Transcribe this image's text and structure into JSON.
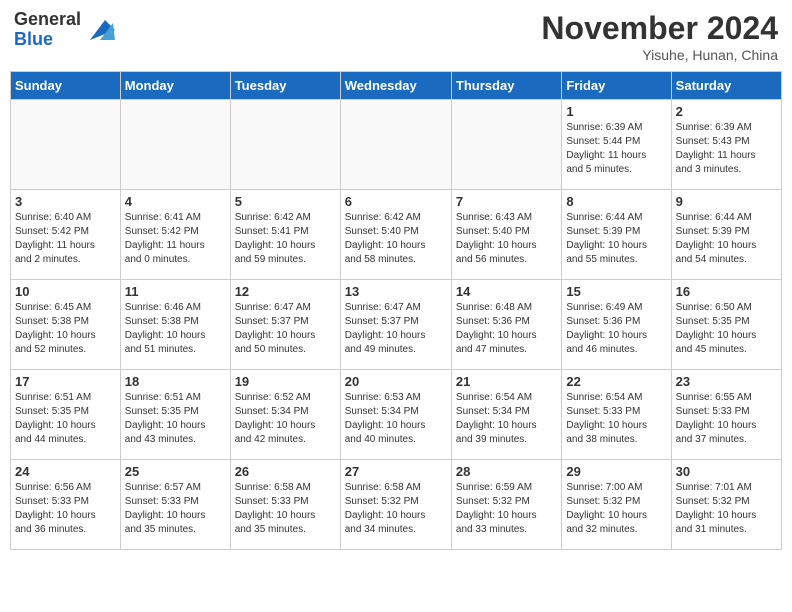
{
  "header": {
    "logo_general": "General",
    "logo_blue": "Blue",
    "month_year": "November 2024",
    "location": "Yisuhe, Hunan, China"
  },
  "weekdays": [
    "Sunday",
    "Monday",
    "Tuesday",
    "Wednesday",
    "Thursday",
    "Friday",
    "Saturday"
  ],
  "weeks": [
    [
      {
        "day": "",
        "info": ""
      },
      {
        "day": "",
        "info": ""
      },
      {
        "day": "",
        "info": ""
      },
      {
        "day": "",
        "info": ""
      },
      {
        "day": "",
        "info": ""
      },
      {
        "day": "1",
        "info": "Sunrise: 6:39 AM\nSunset: 5:44 PM\nDaylight: 11 hours\nand 5 minutes."
      },
      {
        "day": "2",
        "info": "Sunrise: 6:39 AM\nSunset: 5:43 PM\nDaylight: 11 hours\nand 3 minutes."
      }
    ],
    [
      {
        "day": "3",
        "info": "Sunrise: 6:40 AM\nSunset: 5:42 PM\nDaylight: 11 hours\nand 2 minutes."
      },
      {
        "day": "4",
        "info": "Sunrise: 6:41 AM\nSunset: 5:42 PM\nDaylight: 11 hours\nand 0 minutes."
      },
      {
        "day": "5",
        "info": "Sunrise: 6:42 AM\nSunset: 5:41 PM\nDaylight: 10 hours\nand 59 minutes."
      },
      {
        "day": "6",
        "info": "Sunrise: 6:42 AM\nSunset: 5:40 PM\nDaylight: 10 hours\nand 58 minutes."
      },
      {
        "day": "7",
        "info": "Sunrise: 6:43 AM\nSunset: 5:40 PM\nDaylight: 10 hours\nand 56 minutes."
      },
      {
        "day": "8",
        "info": "Sunrise: 6:44 AM\nSunset: 5:39 PM\nDaylight: 10 hours\nand 55 minutes."
      },
      {
        "day": "9",
        "info": "Sunrise: 6:44 AM\nSunset: 5:39 PM\nDaylight: 10 hours\nand 54 minutes."
      }
    ],
    [
      {
        "day": "10",
        "info": "Sunrise: 6:45 AM\nSunset: 5:38 PM\nDaylight: 10 hours\nand 52 minutes."
      },
      {
        "day": "11",
        "info": "Sunrise: 6:46 AM\nSunset: 5:38 PM\nDaylight: 10 hours\nand 51 minutes."
      },
      {
        "day": "12",
        "info": "Sunrise: 6:47 AM\nSunset: 5:37 PM\nDaylight: 10 hours\nand 50 minutes."
      },
      {
        "day": "13",
        "info": "Sunrise: 6:47 AM\nSunset: 5:37 PM\nDaylight: 10 hours\nand 49 minutes."
      },
      {
        "day": "14",
        "info": "Sunrise: 6:48 AM\nSunset: 5:36 PM\nDaylight: 10 hours\nand 47 minutes."
      },
      {
        "day": "15",
        "info": "Sunrise: 6:49 AM\nSunset: 5:36 PM\nDaylight: 10 hours\nand 46 minutes."
      },
      {
        "day": "16",
        "info": "Sunrise: 6:50 AM\nSunset: 5:35 PM\nDaylight: 10 hours\nand 45 minutes."
      }
    ],
    [
      {
        "day": "17",
        "info": "Sunrise: 6:51 AM\nSunset: 5:35 PM\nDaylight: 10 hours\nand 44 minutes."
      },
      {
        "day": "18",
        "info": "Sunrise: 6:51 AM\nSunset: 5:35 PM\nDaylight: 10 hours\nand 43 minutes."
      },
      {
        "day": "19",
        "info": "Sunrise: 6:52 AM\nSunset: 5:34 PM\nDaylight: 10 hours\nand 42 minutes."
      },
      {
        "day": "20",
        "info": "Sunrise: 6:53 AM\nSunset: 5:34 PM\nDaylight: 10 hours\nand 40 minutes."
      },
      {
        "day": "21",
        "info": "Sunrise: 6:54 AM\nSunset: 5:34 PM\nDaylight: 10 hours\nand 39 minutes."
      },
      {
        "day": "22",
        "info": "Sunrise: 6:54 AM\nSunset: 5:33 PM\nDaylight: 10 hours\nand 38 minutes."
      },
      {
        "day": "23",
        "info": "Sunrise: 6:55 AM\nSunset: 5:33 PM\nDaylight: 10 hours\nand 37 minutes."
      }
    ],
    [
      {
        "day": "24",
        "info": "Sunrise: 6:56 AM\nSunset: 5:33 PM\nDaylight: 10 hours\nand 36 minutes."
      },
      {
        "day": "25",
        "info": "Sunrise: 6:57 AM\nSunset: 5:33 PM\nDaylight: 10 hours\nand 35 minutes."
      },
      {
        "day": "26",
        "info": "Sunrise: 6:58 AM\nSunset: 5:33 PM\nDaylight: 10 hours\nand 35 minutes."
      },
      {
        "day": "27",
        "info": "Sunrise: 6:58 AM\nSunset: 5:32 PM\nDaylight: 10 hours\nand 34 minutes."
      },
      {
        "day": "28",
        "info": "Sunrise: 6:59 AM\nSunset: 5:32 PM\nDaylight: 10 hours\nand 33 minutes."
      },
      {
        "day": "29",
        "info": "Sunrise: 7:00 AM\nSunset: 5:32 PM\nDaylight: 10 hours\nand 32 minutes."
      },
      {
        "day": "30",
        "info": "Sunrise: 7:01 AM\nSunset: 5:32 PM\nDaylight: 10 hours\nand 31 minutes."
      }
    ]
  ]
}
